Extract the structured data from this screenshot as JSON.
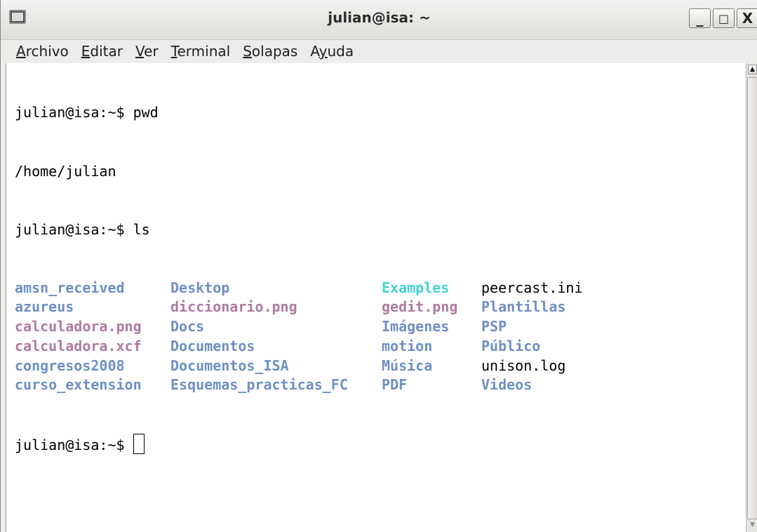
{
  "window": {
    "title": "julian@isa: ~",
    "minimize_label": "_",
    "maximize_label": "□",
    "close_label": "X"
  },
  "menu": {
    "items": [
      {
        "accel": "A",
        "rest": "rchivo"
      },
      {
        "accel": "E",
        "rest": "ditar"
      },
      {
        "accel": "V",
        "rest": "er"
      },
      {
        "accel": "T",
        "rest": "erminal"
      },
      {
        "accel": "S",
        "rest": "olapas"
      },
      {
        "accel": "y",
        "pre": "A",
        "rest": "uda"
      }
    ]
  },
  "terminal": {
    "lines": [
      "julian@isa:~$ pwd",
      "/home/julian",
      "julian@isa:~$ ls"
    ],
    "ls_output": [
      [
        {
          "text": "amsn_received",
          "kind": "dir"
        },
        {
          "text": "Desktop",
          "kind": "dir"
        },
        {
          "text": "Examples",
          "kind": "link"
        },
        {
          "text": "peercast.ini",
          "kind": "file"
        }
      ],
      [
        {
          "text": "azureus",
          "kind": "dir"
        },
        {
          "text": "diccionario.png",
          "kind": "img"
        },
        {
          "text": "gedit.png",
          "kind": "img"
        },
        {
          "text": "Plantillas",
          "kind": "dir"
        }
      ],
      [
        {
          "text": "calculadora.png",
          "kind": "img"
        },
        {
          "text": "Docs",
          "kind": "dir"
        },
        {
          "text": "Imágenes",
          "kind": "dir"
        },
        {
          "text": "PSP",
          "kind": "dir"
        }
      ],
      [
        {
          "text": "calculadora.xcf",
          "kind": "img"
        },
        {
          "text": "Documentos",
          "kind": "dir"
        },
        {
          "text": "motion",
          "kind": "dir"
        },
        {
          "text": "Público",
          "kind": "dir"
        }
      ],
      [
        {
          "text": "congresos2008",
          "kind": "dir"
        },
        {
          "text": "Documentos_ISA",
          "kind": "dir"
        },
        {
          "text": "Música",
          "kind": "dir"
        },
        {
          "text": "unison.log",
          "kind": "file"
        }
      ],
      [
        {
          "text": "curso_extension",
          "kind": "dir"
        },
        {
          "text": "Esquemas_practicas_FC",
          "kind": "dir"
        },
        {
          "text": "PDF",
          "kind": "dir"
        },
        {
          "text": "Videos",
          "kind": "dir"
        }
      ]
    ],
    "prompt": "julian@isa:~$ "
  },
  "colors": {
    "dir": "#6f8fc4",
    "img": "#b07ba0",
    "link": "#44d3d3",
    "file": "#000000"
  }
}
